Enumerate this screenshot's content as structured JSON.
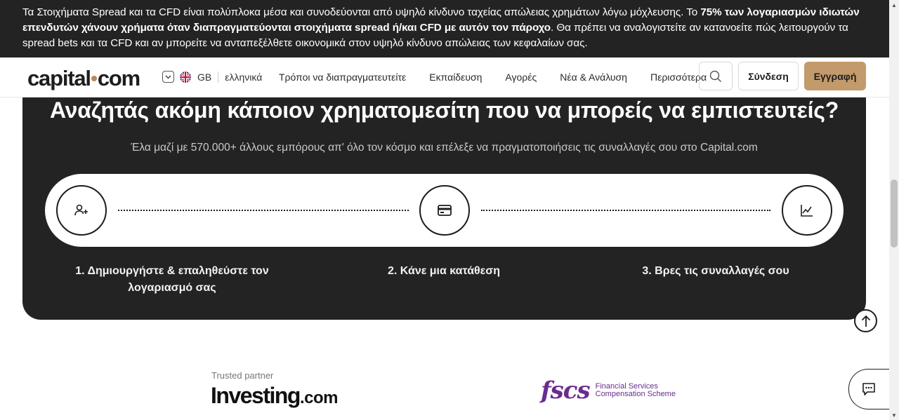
{
  "risk_banner": {
    "part1": "Τα Στοιχήματα Spread και τα CFD είναι πολύπλοκα μέσα και συνοδεύονται από υψηλό κίνδυνο ταχείας απώλειας χρημάτων λόγω μόχλευσης. Το ",
    "bold": "75% των λογαριασμών ιδιωτών επενδυτών χάνουν χρήματα όταν διαπραγματεύονται στοιχήματα spread ή/και CFD με αυτόν τον πάροχο",
    "part2": ". Θα πρέπει να αναλογιστείτε αν κατανοείτε πώς λειτουργούν τα spread bets και τα CFD και αν μπορείτε να ανταπεξέλθετε οικονομικά στον υψηλό κίνδυνο απώλειας των κεφαλαίων σας."
  },
  "header": {
    "logo_left": "capital",
    "logo_right": "com",
    "region": "GB",
    "language": "ελληνικά",
    "nav": [
      "Τρόποι να διαπραγματευτείτε",
      "Εκπαίδευση",
      "Αγορές",
      "Νέα & Ανάλυση",
      "Περισσότερα"
    ],
    "login": "Σύνδεση",
    "signup": "Εγγραφή"
  },
  "promo": {
    "title": "Αναζητάς ακόμη κάποιον χρηματομεσίτη που να μπορείς να εμπιστευτείς?",
    "subtitle": "Έλα μαζί με 570.000+ άλλους εμπόρους απ' όλο τον κόσμο και επέλεξε να πραγματοποιήσεις τις συναλλαγές σου στο Capital.com",
    "steps": [
      {
        "label": "1. Δημιουργήστε & επαληθεύστε τον λογαριασμό σας",
        "icon": "add-user-icon"
      },
      {
        "label": "2. Κάνε μια κατάθεση",
        "icon": "credit-card-icon"
      },
      {
        "label": "3. Βρες τις συναλλαγές σου",
        "icon": "chart-line-icon"
      }
    ]
  },
  "partners": {
    "trusted_label": "Trusted partner",
    "investing_main": "Investing",
    "investing_suffix": ".com",
    "fscs_mark": "fscs",
    "fscs_line1": "Financial Services",
    "fscs_line2": "Compensation Scheme"
  },
  "colors": {
    "dark_bg": "#232323",
    "accent": "#c39a6b",
    "fscs_purple": "#6a2c8f"
  }
}
